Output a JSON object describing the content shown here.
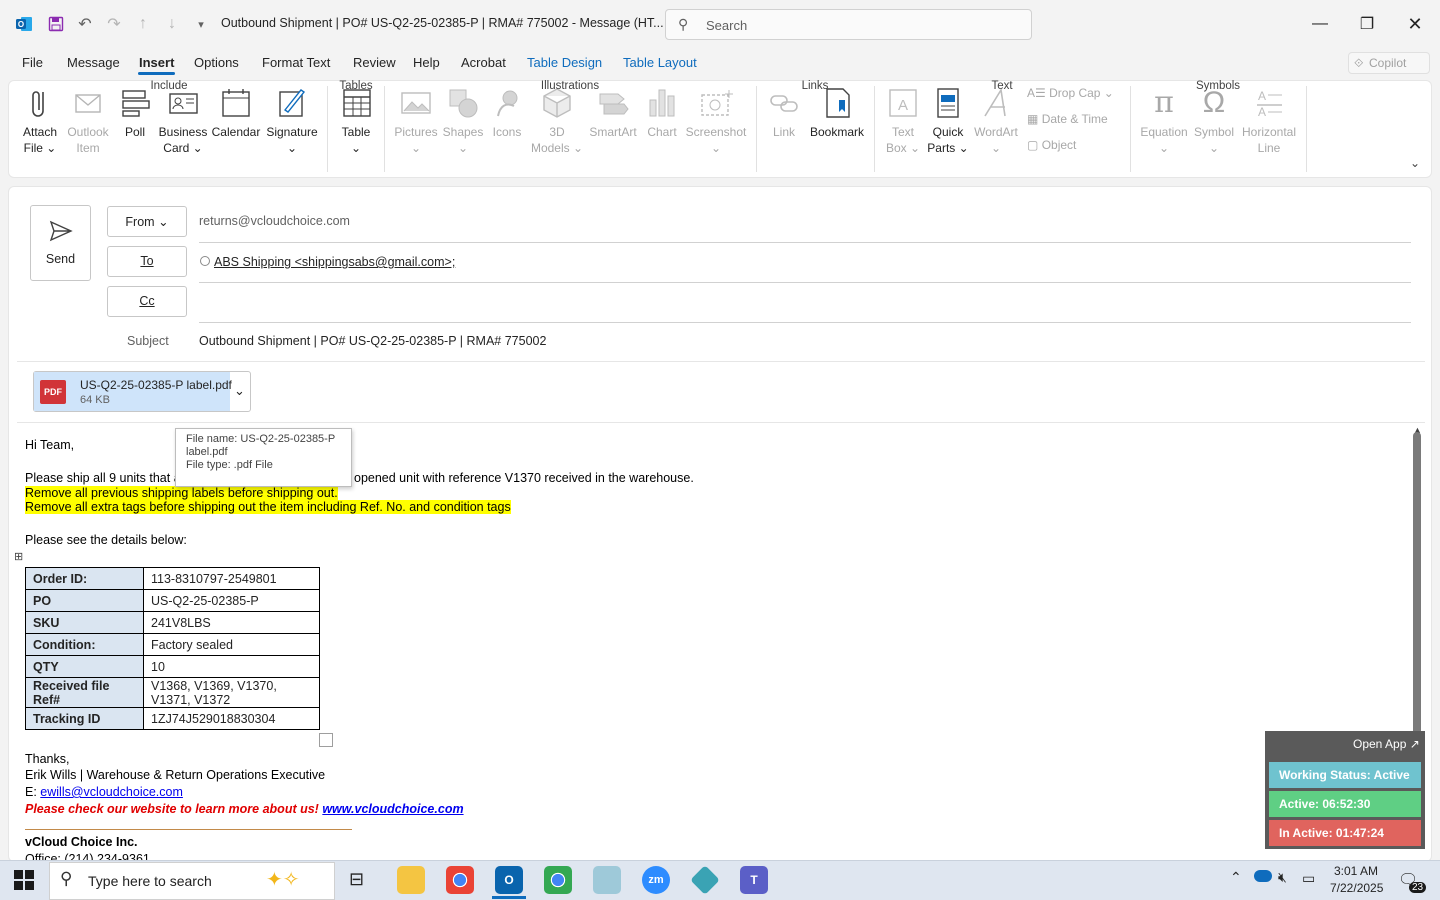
{
  "titlebar": {
    "title": "Outbound Shipment | PO# US-Q2-25-02385-P | RMA# 775002  -  Message (HT...",
    "search_placeholder": "Search"
  },
  "menu": {
    "tabs": [
      "File",
      "Message",
      "Insert",
      "Options",
      "Format Text",
      "Review",
      "Help",
      "Acrobat",
      "Table Design",
      "Table Layout"
    ],
    "active": "Insert",
    "copilot": "Copilot"
  },
  "ribbon": {
    "include": {
      "label": "Include",
      "attach": "Attach",
      "attach2": "File",
      "outlook": "Outlook",
      "outlook2": "Item",
      "poll": "Poll",
      "business": "Business",
      "business2": "Card",
      "calendar": "Calendar",
      "signature": "Signature"
    },
    "tables": {
      "label": "Tables",
      "table": "Table"
    },
    "illustrations": {
      "label": "Illustrations",
      "pictures": "Pictures",
      "shapes": "Shapes",
      "icons": "Icons",
      "models": "3D",
      "models2": "Models",
      "smartart": "SmartArt",
      "chart": "Chart",
      "screenshot": "Screenshot"
    },
    "links": {
      "label": "Links",
      "link": "Link",
      "bookmark": "Bookmark"
    },
    "text": {
      "label": "Text",
      "textbox": "Text",
      "textbox2": "Box",
      "quickparts": "Quick",
      "quickparts2": "Parts",
      "wordart": "WordArt",
      "dropcap": "Drop Cap",
      "datetime": "Date & Time",
      "object": "Object"
    },
    "symbols": {
      "label": "Symbols",
      "equation": "Equation",
      "symbol": "Symbol",
      "hline": "Horizontal",
      "hline2": "Line"
    }
  },
  "compose": {
    "send": "Send",
    "from_label": "From",
    "from_value": "returns@vcloudchoice.com",
    "to_label": "To",
    "to_value": "ABS Shipping <shippingsabs@gmail.com>;",
    "cc_label": "Cc",
    "subject_label": "Subject",
    "subject_value": "Outbound Shipment | PO# US-Q2-25-02385-P | RMA# 775002",
    "attachment": {
      "name": "US-Q2-25-02385-P label.pdf",
      "size": "64 KB",
      "badge": "PDF"
    },
    "tooltip": {
      "l1": "File name:  US-Q2-25-02385-P",
      "l2": "label.pdf",
      "l3": "File type:  .pdf File"
    }
  },
  "body": {
    "greeting": "Hi Team,",
    "line1a": "Please ship all 9 units that a",
    "line1b": "opened unit with reference V1370 received in the warehouse.",
    "hl1": "Remove all previous shipping labels before shipping out.",
    "hl2": "Remove all extra tags before shipping out the item including Ref. No. and condition tags",
    "details_intro": "Please see the details below:",
    "table": [
      {
        "k": "Order ID:",
        "v": "113-8310797-2549801"
      },
      {
        "k": "PO",
        "v": "US-Q2-25-02385-P"
      },
      {
        "k": "SKU",
        "v": "241V8LBS"
      },
      {
        "k": "Condition:",
        "v": "Factory sealed"
      },
      {
        "k": "QTY",
        "v": "10"
      },
      {
        "k": "Received file Ref#",
        "v": "V1368, V1369, V1370,",
        "v2": "V1371, V1372"
      },
      {
        "k": "Tracking ID",
        "v": "1ZJ74J529018830304"
      }
    ],
    "thanks": "Thanks,",
    "sig_name": "Erik Wills | Warehouse & Return Operations Executive",
    "sig_email_label": "E: ",
    "sig_email": "ewills@vcloudchoice.com",
    "promo": "Please check our website to learn more about us! ",
    "promo_link": "www.vcloudchoice.com",
    "company": "vCloud Choice Inc.",
    "office": "Office: (214) 234-9361"
  },
  "widget": {
    "open_app": "Open App",
    "status": "Working Status: Active",
    "active": "Active: 06:52:30",
    "inactive": "In Active: 01:47:24",
    "colors": {
      "status": "#6fc3cf",
      "active": "#5fcf84",
      "inactive": "#e0645e"
    }
  },
  "taskbar": {
    "search": "Type here to search",
    "time": "3:01 AM",
    "date": "7/22/2025",
    "notifications": "23"
  }
}
